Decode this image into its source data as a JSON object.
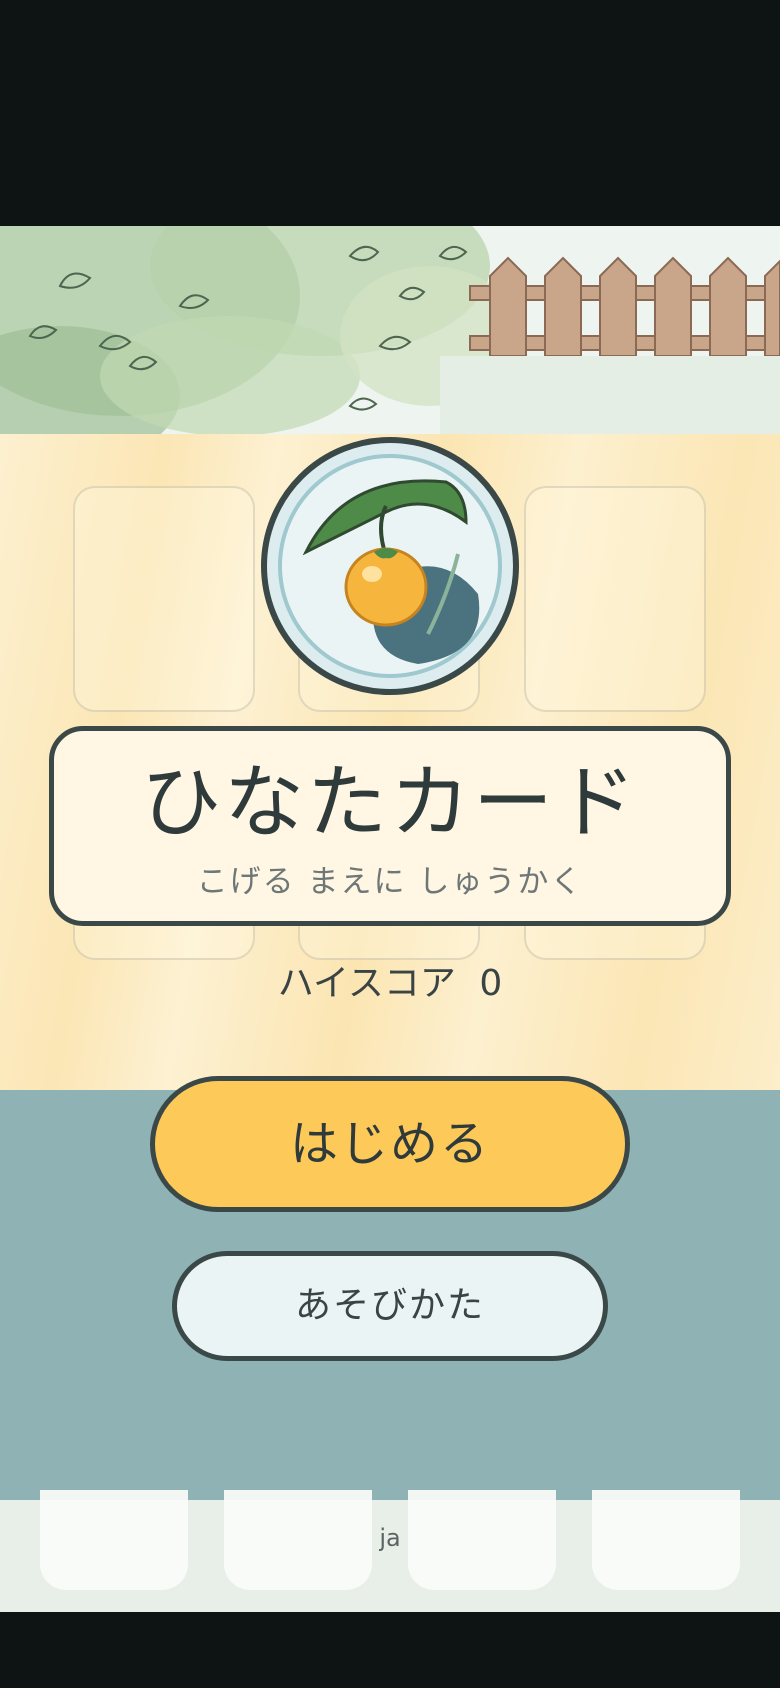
{
  "game": {
    "title": "ひなたカード",
    "subtitle": "こげる まえに しゅうかく",
    "high_score_label": "ハイスコア",
    "high_score_value": "0",
    "start_button": "はじめる",
    "how_to_play_button": "あそびかた",
    "language": "ja"
  },
  "colors": {
    "background_yellow": "#fbefcf",
    "teal_band": "#8fb2b5",
    "start_button": "#fdc959",
    "outline": "#3a4848"
  },
  "icons": {
    "emblem": "orange-fruit-emblem-icon",
    "header": "leaves-and-fence-illustration"
  }
}
